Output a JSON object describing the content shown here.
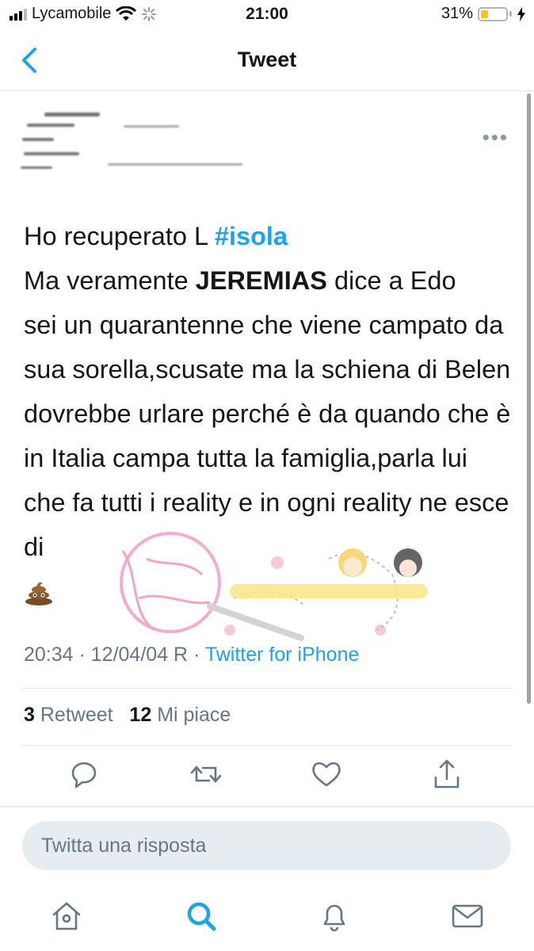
{
  "status_bar": {
    "carrier": "Lycamobile",
    "time": "21:00",
    "battery": "31%",
    "battery_level": 0.31
  },
  "nav": {
    "title": "Tweet"
  },
  "tweet": {
    "line1_prefix": "Ho recuperato L ",
    "hashtag": "#isola",
    "line2_prefix": "Ma veramente ",
    "bold_name": "JEREMIAS",
    "line2_suffix": " dice a Edo",
    "body_rest": "sei un quarantenne che viene campato da sua sorella,scusate ma la schiena di Belen dovrebbe urlare perché è da quando che è in Italia campa tutta la famiglia,parla lui che fa tutti i reality e in ogni reality ne esce di",
    "emoji_icon": "poop-emoji-icon",
    "timestamp": "20:34 · 12/04/04 R · ",
    "source": "Twitter for iPhone"
  },
  "stats": {
    "retweet_count": "3",
    "retweet_label": "Retweet",
    "like_count": "12",
    "like_label": "Mi piace"
  },
  "actions": [
    "reply-icon",
    "retweet-icon",
    "like-icon",
    "share-icon"
  ],
  "reply": {
    "placeholder": "Twitta una risposta"
  },
  "tabbar": [
    "home-icon",
    "search-icon",
    "notifications-icon",
    "messages-icon"
  ],
  "colors": {
    "accent": "#1da1f2",
    "text": "#14171a",
    "secondary": "#657786",
    "divider": "#e1e8ed"
  }
}
